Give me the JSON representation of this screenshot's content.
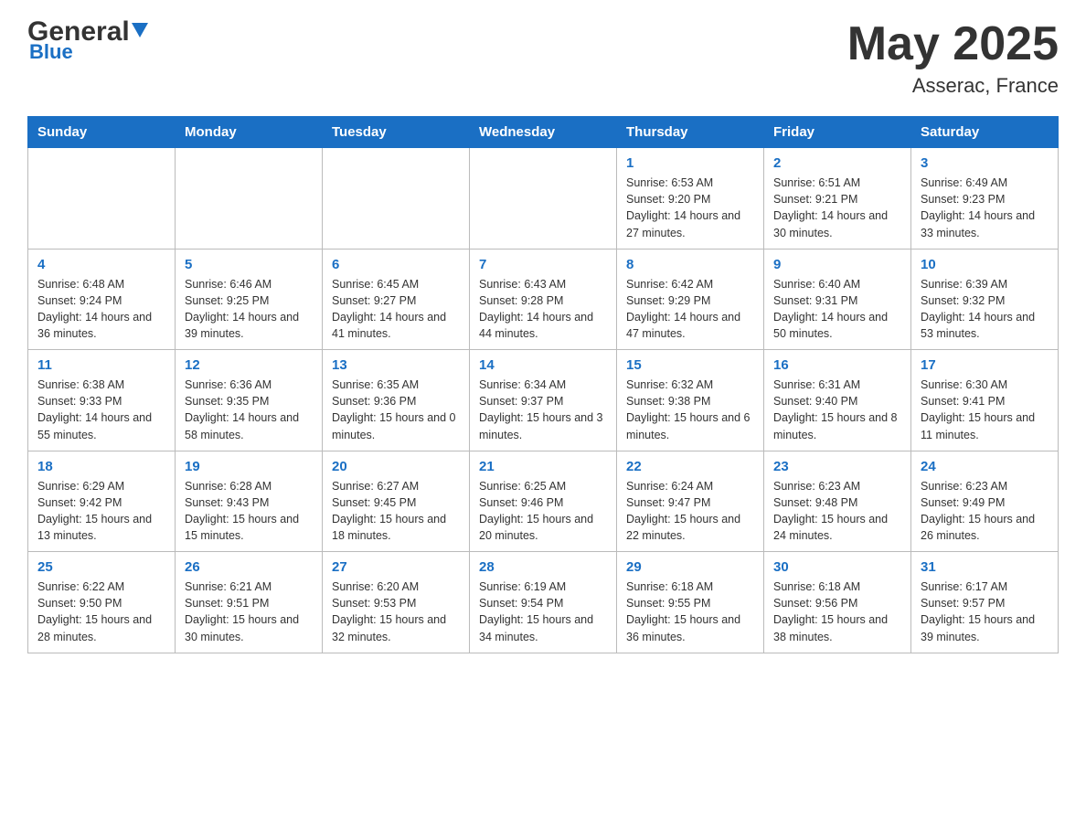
{
  "header": {
    "logo_general": "General",
    "logo_blue": "Blue",
    "month_title": "May 2025",
    "location": "Asserac, France"
  },
  "days_of_week": [
    "Sunday",
    "Monday",
    "Tuesday",
    "Wednesday",
    "Thursday",
    "Friday",
    "Saturday"
  ],
  "weeks": [
    [
      {
        "day": "",
        "info": ""
      },
      {
        "day": "",
        "info": ""
      },
      {
        "day": "",
        "info": ""
      },
      {
        "day": "",
        "info": ""
      },
      {
        "day": "1",
        "info": "Sunrise: 6:53 AM\nSunset: 9:20 PM\nDaylight: 14 hours and 27 minutes."
      },
      {
        "day": "2",
        "info": "Sunrise: 6:51 AM\nSunset: 9:21 PM\nDaylight: 14 hours and 30 minutes."
      },
      {
        "day": "3",
        "info": "Sunrise: 6:49 AM\nSunset: 9:23 PM\nDaylight: 14 hours and 33 minutes."
      }
    ],
    [
      {
        "day": "4",
        "info": "Sunrise: 6:48 AM\nSunset: 9:24 PM\nDaylight: 14 hours and 36 minutes."
      },
      {
        "day": "5",
        "info": "Sunrise: 6:46 AM\nSunset: 9:25 PM\nDaylight: 14 hours and 39 minutes."
      },
      {
        "day": "6",
        "info": "Sunrise: 6:45 AM\nSunset: 9:27 PM\nDaylight: 14 hours and 41 minutes."
      },
      {
        "day": "7",
        "info": "Sunrise: 6:43 AM\nSunset: 9:28 PM\nDaylight: 14 hours and 44 minutes."
      },
      {
        "day": "8",
        "info": "Sunrise: 6:42 AM\nSunset: 9:29 PM\nDaylight: 14 hours and 47 minutes."
      },
      {
        "day": "9",
        "info": "Sunrise: 6:40 AM\nSunset: 9:31 PM\nDaylight: 14 hours and 50 minutes."
      },
      {
        "day": "10",
        "info": "Sunrise: 6:39 AM\nSunset: 9:32 PM\nDaylight: 14 hours and 53 minutes."
      }
    ],
    [
      {
        "day": "11",
        "info": "Sunrise: 6:38 AM\nSunset: 9:33 PM\nDaylight: 14 hours and 55 minutes."
      },
      {
        "day": "12",
        "info": "Sunrise: 6:36 AM\nSunset: 9:35 PM\nDaylight: 14 hours and 58 minutes."
      },
      {
        "day": "13",
        "info": "Sunrise: 6:35 AM\nSunset: 9:36 PM\nDaylight: 15 hours and 0 minutes."
      },
      {
        "day": "14",
        "info": "Sunrise: 6:34 AM\nSunset: 9:37 PM\nDaylight: 15 hours and 3 minutes."
      },
      {
        "day": "15",
        "info": "Sunrise: 6:32 AM\nSunset: 9:38 PM\nDaylight: 15 hours and 6 minutes."
      },
      {
        "day": "16",
        "info": "Sunrise: 6:31 AM\nSunset: 9:40 PM\nDaylight: 15 hours and 8 minutes."
      },
      {
        "day": "17",
        "info": "Sunrise: 6:30 AM\nSunset: 9:41 PM\nDaylight: 15 hours and 11 minutes."
      }
    ],
    [
      {
        "day": "18",
        "info": "Sunrise: 6:29 AM\nSunset: 9:42 PM\nDaylight: 15 hours and 13 minutes."
      },
      {
        "day": "19",
        "info": "Sunrise: 6:28 AM\nSunset: 9:43 PM\nDaylight: 15 hours and 15 minutes."
      },
      {
        "day": "20",
        "info": "Sunrise: 6:27 AM\nSunset: 9:45 PM\nDaylight: 15 hours and 18 minutes."
      },
      {
        "day": "21",
        "info": "Sunrise: 6:25 AM\nSunset: 9:46 PM\nDaylight: 15 hours and 20 minutes."
      },
      {
        "day": "22",
        "info": "Sunrise: 6:24 AM\nSunset: 9:47 PM\nDaylight: 15 hours and 22 minutes."
      },
      {
        "day": "23",
        "info": "Sunrise: 6:23 AM\nSunset: 9:48 PM\nDaylight: 15 hours and 24 minutes."
      },
      {
        "day": "24",
        "info": "Sunrise: 6:23 AM\nSunset: 9:49 PM\nDaylight: 15 hours and 26 minutes."
      }
    ],
    [
      {
        "day": "25",
        "info": "Sunrise: 6:22 AM\nSunset: 9:50 PM\nDaylight: 15 hours and 28 minutes."
      },
      {
        "day": "26",
        "info": "Sunrise: 6:21 AM\nSunset: 9:51 PM\nDaylight: 15 hours and 30 minutes."
      },
      {
        "day": "27",
        "info": "Sunrise: 6:20 AM\nSunset: 9:53 PM\nDaylight: 15 hours and 32 minutes."
      },
      {
        "day": "28",
        "info": "Sunrise: 6:19 AM\nSunset: 9:54 PM\nDaylight: 15 hours and 34 minutes."
      },
      {
        "day": "29",
        "info": "Sunrise: 6:18 AM\nSunset: 9:55 PM\nDaylight: 15 hours and 36 minutes."
      },
      {
        "day": "30",
        "info": "Sunrise: 6:18 AM\nSunset: 9:56 PM\nDaylight: 15 hours and 38 minutes."
      },
      {
        "day": "31",
        "info": "Sunrise: 6:17 AM\nSunset: 9:57 PM\nDaylight: 15 hours and 39 minutes."
      }
    ]
  ]
}
